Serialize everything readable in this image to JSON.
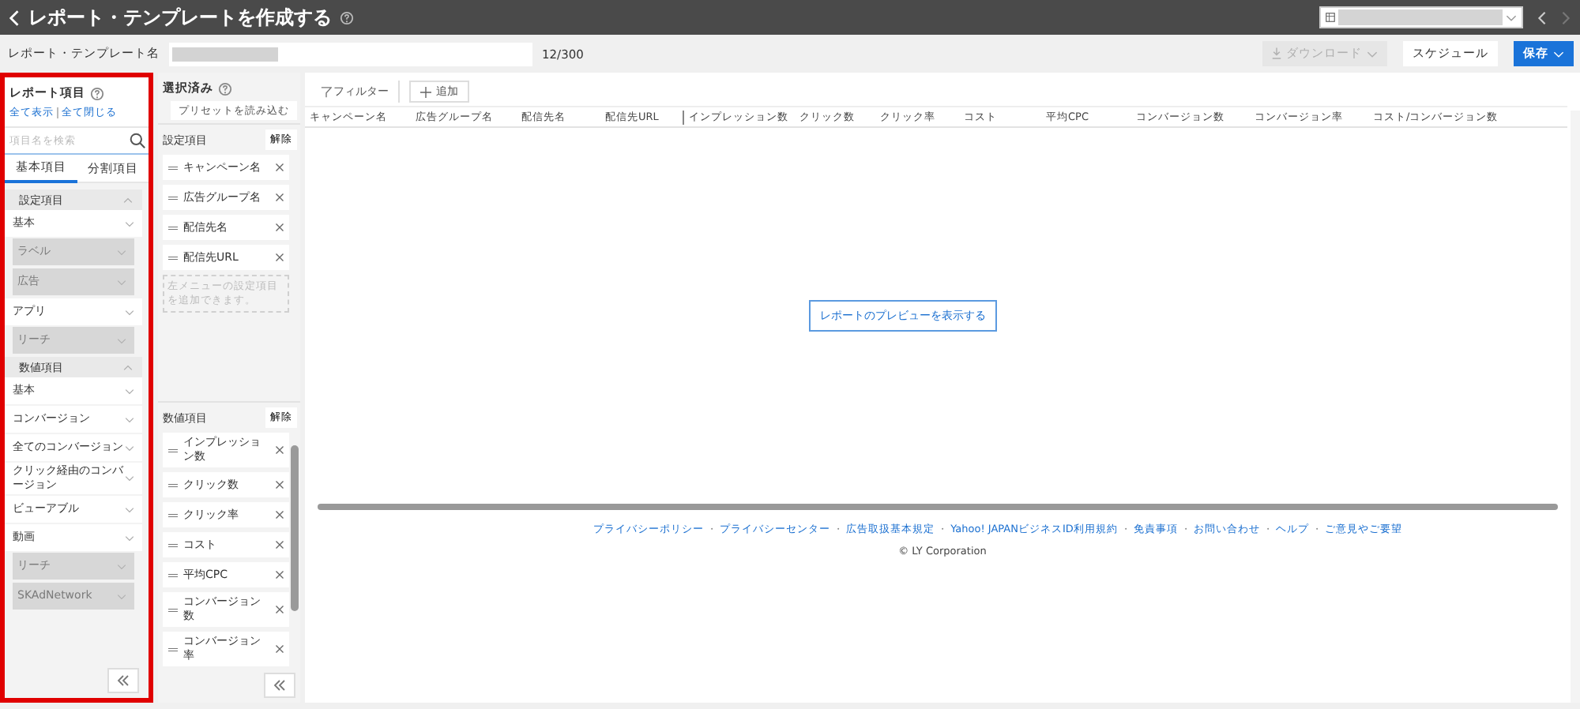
{
  "header": {
    "title": "レポート・テンプレートを作成する"
  },
  "template_name": {
    "label": "レポート・テンプレート名",
    "counter": "12/300"
  },
  "toolbar": {
    "buttons": [
      {
        "label": "ダウンロード",
        "kind": "download",
        "disabled": true
      },
      {
        "label": "スケジュール",
        "kind": "plain",
        "disabled": false
      },
      {
        "label": "保存",
        "kind": "primary",
        "disabled": false
      }
    ]
  },
  "report_items": {
    "title": "レポート項目",
    "show_all": "全て表示",
    "collapse_all": "全て閉じる",
    "search": {
      "placeholder": "項目名を検索"
    },
    "tabs": [
      {
        "label": "基本項目",
        "selected": true
      },
      {
        "label": "分割項目",
        "selected": false
      }
    ],
    "groups": [
      {
        "label": "設定項目",
        "expanded": true,
        "items": [
          {
            "label": "基本",
            "disabled": false
          },
          {
            "label": "ラベル",
            "disabled": true
          },
          {
            "label": "広告",
            "disabled": true
          },
          {
            "label": "アプリ",
            "disabled": false
          },
          {
            "label": "リーチ",
            "disabled": true
          }
        ]
      },
      {
        "label": "数値項目",
        "expanded": true,
        "items": [
          {
            "label": "基本",
            "disabled": false
          },
          {
            "label": "コンバージョン",
            "disabled": false
          },
          {
            "label": "全てのコンバージョン",
            "disabled": false
          },
          {
            "label": "クリック経由のコンバージョン",
            "disabled": false
          },
          {
            "label": "ビューアブル",
            "disabled": false
          },
          {
            "label": "動画",
            "disabled": false
          },
          {
            "label": "リーチ",
            "disabled": true
          },
          {
            "label": "SKAdNetwork",
            "disabled": true
          }
        ]
      }
    ]
  },
  "selected": {
    "title": "選択済み",
    "preset_button": "プリセットを読み込む",
    "sections": [
      {
        "label": "設定項目",
        "clear": "解除",
        "items": [
          "キャンペーン名",
          "広告グループ名",
          "配信先名",
          "配信先URL"
        ],
        "hint": "左メニューの設定項目を追加できます。"
      },
      {
        "label": "数値項目",
        "clear": "解除",
        "items": [
          "インプレッション数",
          "クリック数",
          "クリック率",
          "コスト",
          "平均CPC",
          "コンバージョン数",
          "コンバージョン率"
        ]
      }
    ]
  },
  "preview": {
    "filter": "フィルター",
    "add": "追加",
    "columns": [
      "キャンペーン名",
      "広告グループ名",
      "配信先名",
      "配信先URL",
      "インプレッション数",
      "クリック数",
      "クリック率",
      "コスト",
      "平均CPC",
      "コンバージョン数",
      "コンバージョン率",
      "コスト/コンバージョン数"
    ],
    "preview_button": "レポートのプレビューを表示する"
  },
  "footer": {
    "links": [
      "プライバシーポリシー",
      "プライバシーセンター",
      "広告取扱基本規定",
      "Yahoo! JAPANビジネスID利用規約",
      "免責事項",
      "お問い合わせ",
      "ヘルプ",
      "ご意見やご要望"
    ],
    "separator": "・",
    "copyright": "© LY Corporation"
  }
}
